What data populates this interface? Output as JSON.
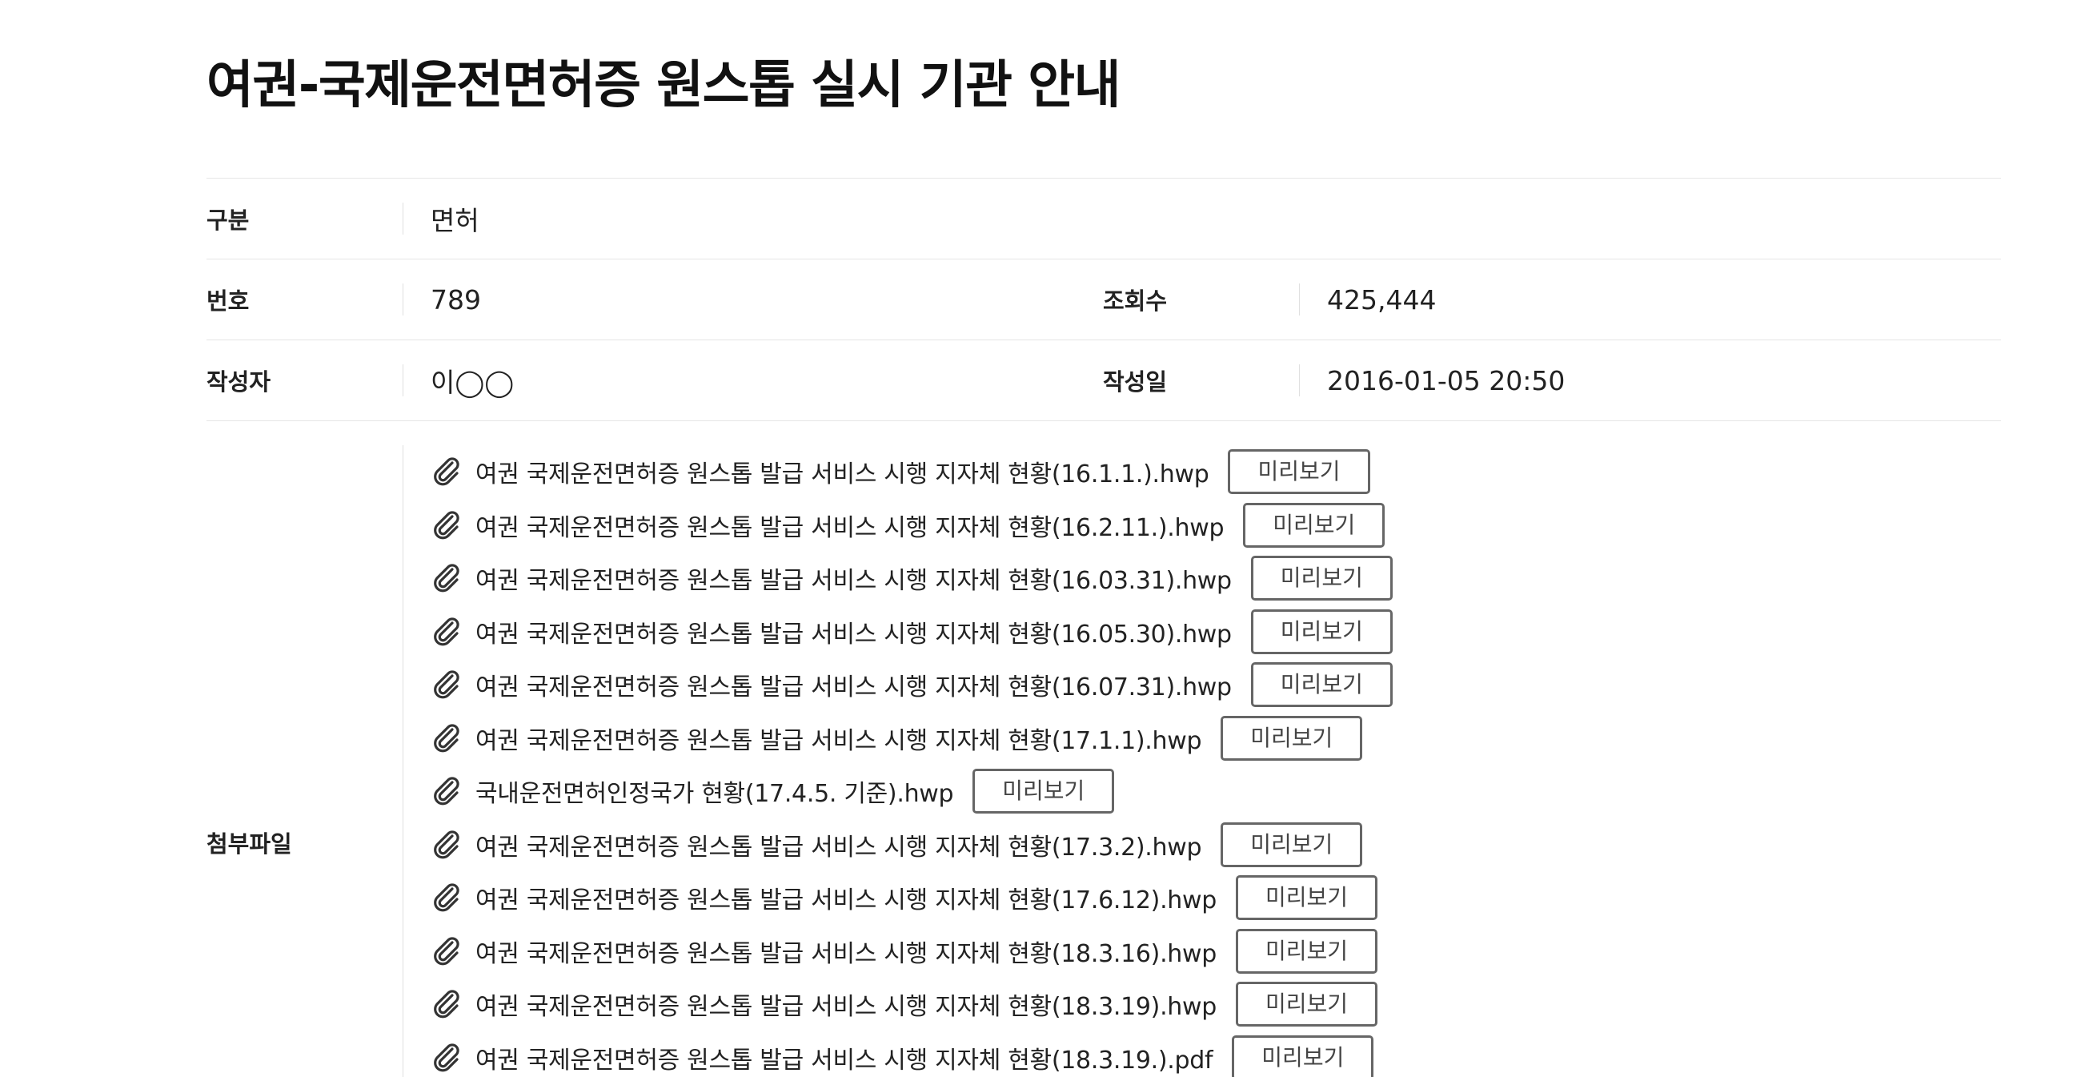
{
  "page": {
    "title": "여권-국제운전면허증 원스톱 실시 기관 안내"
  },
  "info": {
    "category_label": "구분",
    "category_value": "면허",
    "number_label": "번호",
    "number_value": "789",
    "views_label": "조회수",
    "views_value": "425,444",
    "author_label": "작성자",
    "author_value": "이◯◯",
    "date_label": "작성일",
    "date_value": "2016-01-05 20:50"
  },
  "attachments": {
    "label": "첨부파일",
    "preview_label": "미리보기",
    "icon": "paperclip-icon",
    "files": [
      "여권 국제운전면허증 원스톱 발급 서비스 시행 지자체 현황(16.1.1.).hwp",
      "여권 국제운전면허증 원스톱 발급 서비스 시행 지자체 현황(16.2.11.).hwp",
      "여권 국제운전면허증 원스톱 발급 서비스 시행 지자체 현황(16.03.31).hwp",
      "여권 국제운전면허증 원스톱 발급 서비스 시행 지자체 현황(16.05.30).hwp",
      "여권 국제운전면허증 원스톱 발급 서비스 시행 지자체 현황(16.07.31).hwp",
      "여권 국제운전면허증 원스톱 발급 서비스 시행 지자체 현황(17.1.1).hwp",
      "국내운전면허인정국가 현황(17.4.5. 기준).hwp",
      "여권 국제운전면허증 원스톱 발급 서비스 시행 지자체 현황(17.3.2).hwp",
      "여권 국제운전면허증 원스톱 발급 서비스 시행 지자체 현황(17.6.12).hwp",
      "여권 국제운전면허증 원스톱 발급 서비스 시행 지자체 현황(18.3.16).hwp",
      "여권 국제운전면허증 원스톱 발급 서비스 시행 지자체 현황(18.3.19).hwp",
      "여권 국제운전면허증 원스톱 발급 서비스 시행 지자체 현황(18.3.19.).pdf"
    ]
  }
}
